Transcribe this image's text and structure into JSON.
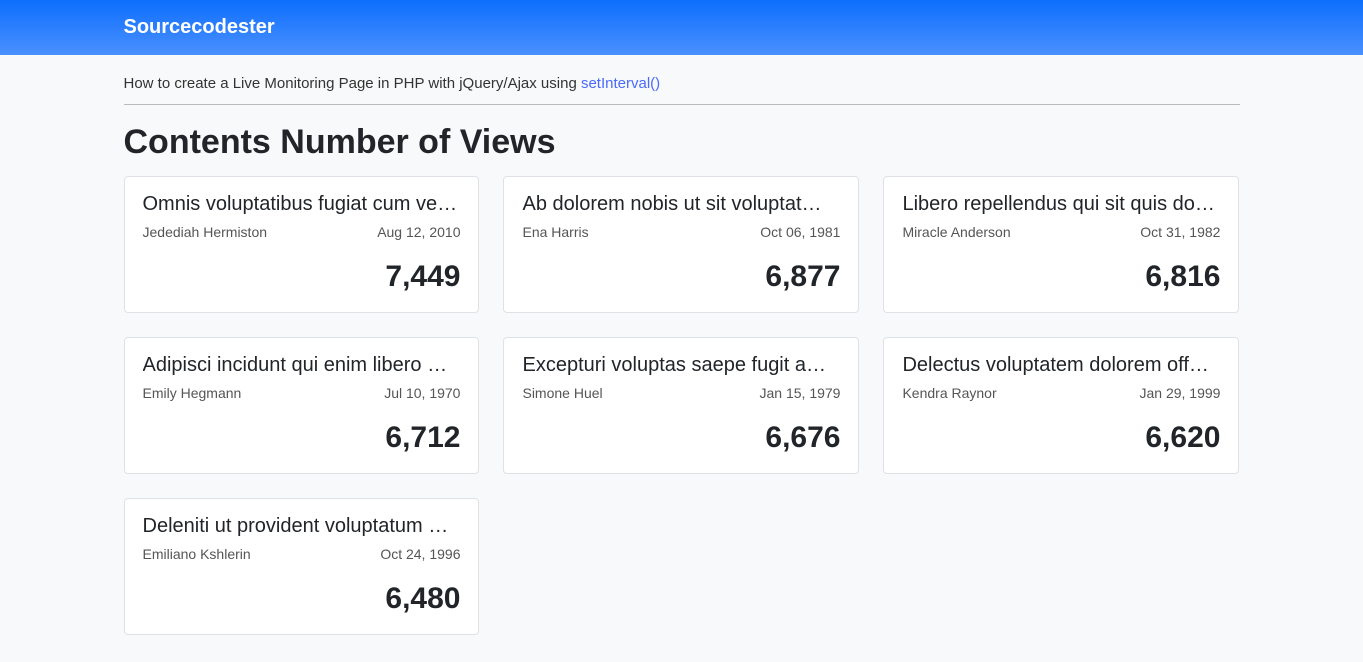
{
  "navbar": {
    "brand": "Sourcecodester"
  },
  "subtitle": {
    "text_before": "How to create a Live Monitoring Page in PHP with jQuery/Ajax using ",
    "link_text": "setInterval()"
  },
  "heading": "Contents Number of Views",
  "cards": [
    {
      "title": "Omnis voluptatibus fugiat cum ve…",
      "author": "Jedediah Hermiston",
      "date": "Aug 12, 2010",
      "views": "7,449"
    },
    {
      "title": "Ab dolorem nobis ut sit voluptat…",
      "author": "Ena Harris",
      "date": "Oct 06, 1981",
      "views": "6,877"
    },
    {
      "title": "Libero repellendus qui sit quis do…",
      "author": "Miracle Anderson",
      "date": "Oct 31, 1982",
      "views": "6,816"
    },
    {
      "title": "Adipisci incidunt qui enim libero …",
      "author": "Emily Hegmann",
      "date": "Jul 10, 1970",
      "views": "6,712"
    },
    {
      "title": "Excepturi voluptas saepe fugit a…",
      "author": "Simone Huel",
      "date": "Jan 15, 1979",
      "views": "6,676"
    },
    {
      "title": "Delectus voluptatem dolorem off…",
      "author": "Kendra Raynor",
      "date": "Jan 29, 1999",
      "views": "6,620"
    },
    {
      "title": "Deleniti ut provident voluptatum …",
      "author": "Emiliano Kshlerin",
      "date": "Oct 24, 1996",
      "views": "6,480"
    }
  ]
}
